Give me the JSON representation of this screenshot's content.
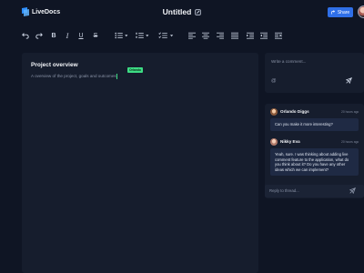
{
  "app": {
    "name": "LiveDocs"
  },
  "document": {
    "title": "Untitled",
    "heading": "Project overview",
    "body": "A overview of the project, goals and outcomes"
  },
  "header": {
    "share_label": "Share"
  },
  "toolbar": {
    "bold": "B",
    "italic": "I",
    "underline": "U",
    "strike": "S"
  },
  "collaborator_cursor": {
    "name": "Orlando",
    "color": "#3ddc84"
  },
  "comments": {
    "compose_placeholder": "Write a comment...",
    "mention_symbol": "@",
    "reply_placeholder": "Reply to thread...",
    "thread": [
      {
        "author": "Orlando Diggs",
        "time": "20 hours ago",
        "text": "Can you make it more interesting?"
      },
      {
        "author": "Nikky Eva",
        "time": "20 hours ago",
        "text": "Yeah, sure. I was thinking about adding live comment feature to the application, what do you think about it? Do you have any other ideas which we can implement?"
      }
    ]
  },
  "colors": {
    "background": "#0f1524",
    "panel": "#161d2d",
    "accent": "#2f6fe8",
    "bubble": "#1f2a44"
  }
}
